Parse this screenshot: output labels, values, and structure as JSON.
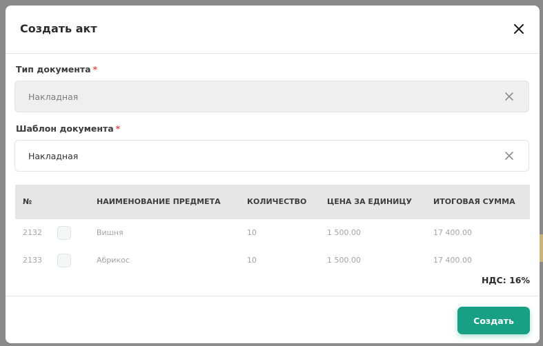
{
  "modal": {
    "title": "Создать акт",
    "close_icon": "close-icon"
  },
  "document_type": {
    "label": "Тип документа",
    "required_mark": "*",
    "value": "Накладная",
    "disabled": true,
    "clear_icon": "clear-icon"
  },
  "document_template": {
    "label": "Шаблон документа",
    "required_mark": "*",
    "value": "Накладная",
    "clear_icon": "clear-icon"
  },
  "table": {
    "headers": {
      "number": "№",
      "name": "НАИМЕНОВАНИЕ ПРЕДМЕТА",
      "quantity": "КОЛИЧЕСТВО",
      "unit_price": "ЦЕНА ЗА ЕДИНИЦУ",
      "total": "ИТОГОВАЯ СУММА"
    },
    "rows": [
      {
        "number": "2132",
        "checked": false,
        "name": "Вишня",
        "quantity": "10",
        "unit_price": "1 500.00",
        "total": "17 400.00"
      },
      {
        "number": "2133",
        "checked": false,
        "name": "Абрикос",
        "quantity": "10",
        "unit_price": "1 500.00",
        "total": "17 400.00"
      }
    ]
  },
  "vat_text": "НДС: 16%",
  "create_button": "Создать",
  "colors": {
    "accent": "#17a084",
    "required": "#e5534b"
  }
}
